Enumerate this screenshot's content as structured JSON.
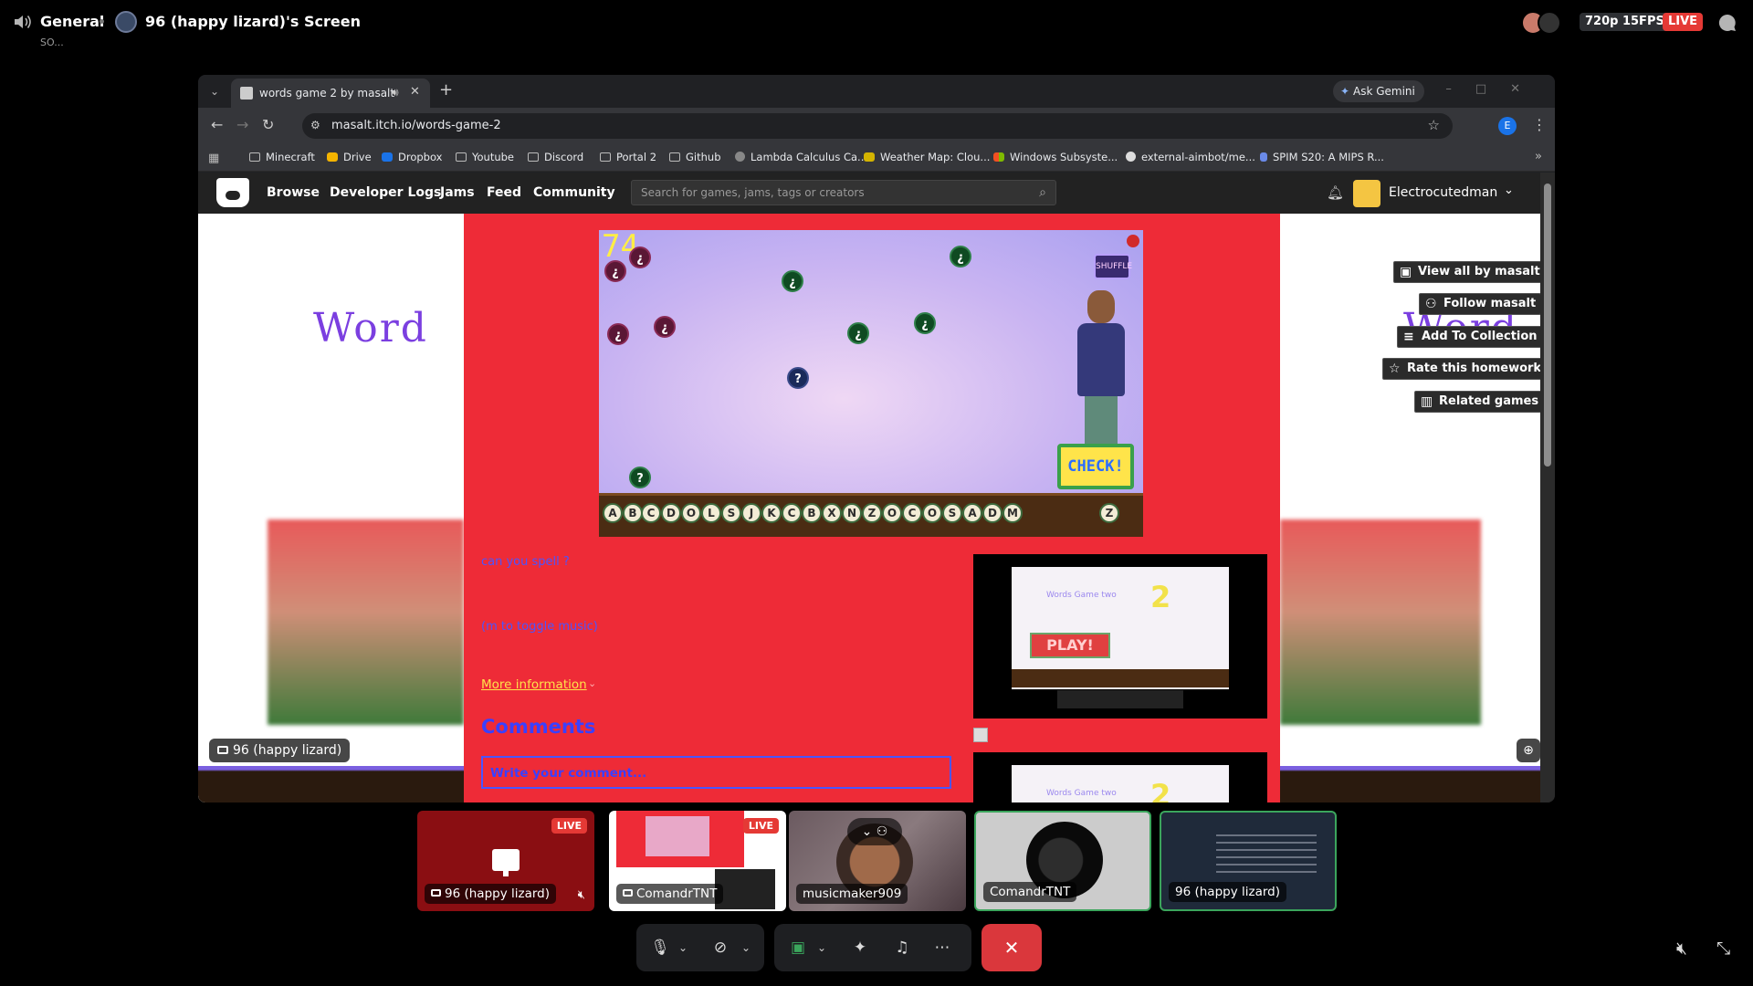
{
  "header": {
    "channel": "General",
    "screen_title": "96 (happy lizard)'s Screen",
    "subtitle": "SO...",
    "quality": "720p 15FPS",
    "live": "LIVE"
  },
  "browser": {
    "tab_title": "words game 2 by masalt",
    "gemini": "Ask Gemini",
    "url": "masalt.itch.io/words-game-2",
    "profile_initial": "E",
    "bookmarks": [
      "Minecraft",
      "Drive",
      "Dropbox",
      "Youtube",
      "Discord",
      "Portal 2",
      "Github",
      "Lambda Calculus Ca...",
      "Weather Map: Clou...",
      "Windows Subsyste...",
      "external-aimbot/me...",
      "SPIM S20: A MIPS R..."
    ]
  },
  "itch": {
    "nav": [
      "Browse",
      "Developer Logs",
      "Jams",
      "Feed",
      "Community"
    ],
    "search_placeholder": "Search for games, jams, tags or creators",
    "username": "Electrocutedman",
    "side_buttons": [
      "View all by masalt",
      "Follow masalt",
      "Add To Collection",
      "Rate this homework",
      "Related games"
    ],
    "word_logo": "Word",
    "game": {
      "score": "74",
      "shuffle": "SHUFFLE",
      "check": "CHECK!",
      "bubbles": [
        "¿",
        "¿",
        "¿",
        "¿",
        "¿",
        "¿",
        "¿",
        "¿",
        "?",
        "?"
      ],
      "tiles": [
        "A",
        "B",
        "C",
        "D",
        "O",
        "L",
        "S",
        "J",
        "K",
        "C",
        "B",
        "X",
        "N",
        "Z",
        "O",
        "C",
        "O",
        "S",
        "A",
        "D",
        "M",
        "Z"
      ]
    },
    "description": [
      "can you spell ?",
      "(m to toggle music)"
    ],
    "more_info": "More information",
    "comments_heading": "Comments",
    "comment_placeholder": "Write your comment...",
    "screenshot": {
      "title": "Words Game two",
      "two": "2",
      "play": "PLAY!"
    }
  },
  "stream_owner": "96 (happy lizard)",
  "participants": [
    {
      "name": "96 (happy lizard)",
      "live": "LIVE"
    },
    {
      "name": "ComandrTNT",
      "live": "LIVE"
    },
    {
      "name": "musicmaker909"
    },
    {
      "name": "ComandrTNT"
    },
    {
      "name": "96 (happy lizard)"
    }
  ],
  "colors": {
    "itch_red": "#ee2b37",
    "live_red": "#e53935",
    "active_green": "#3ba55c",
    "leave_red": "#da373c"
  }
}
